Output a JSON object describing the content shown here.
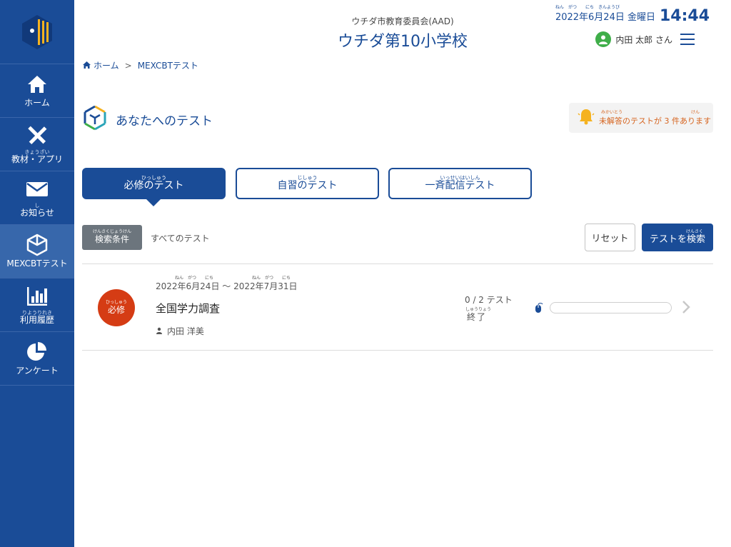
{
  "sidebar": {
    "items": [
      {
        "label": "ホーム",
        "ruby": "",
        "icon": "home-icon",
        "active": false
      },
      {
        "label": "教材・アプリ",
        "ruby": "きょうざい",
        "icon": "pencil-ruler-icon",
        "active": false
      },
      {
        "label": "お知らせ",
        "ruby": "し",
        "icon": "mail-icon",
        "active": false
      },
      {
        "label": "MEXCBTテスト",
        "ruby": "",
        "icon": "cube-icon",
        "active": true
      },
      {
        "label": "利用履歴",
        "ruby": "りようりれき",
        "icon": "bar-chart-icon",
        "active": false
      },
      {
        "label": "アンケート",
        "ruby": "",
        "icon": "pie-chart-icon",
        "active": false
      }
    ]
  },
  "header": {
    "org": "ウチダ市教育委員会(AAD)",
    "school": "ウチダ第10小学校",
    "date": "2022年6月24日 金曜日",
    "date_ruby": "ねん　がつ　　にち　きんようび",
    "time": "14:44",
    "user": "内田 太郎 さん"
  },
  "breadcrumb": {
    "home": "ホーム",
    "separator": ">",
    "current": "MEXCBTテスト"
  },
  "section": {
    "title": "あなたへのテスト"
  },
  "alert": {
    "text": "未解答のテストが 3 件あります",
    "ruby1": "みかいとう",
    "ruby2": "けん"
  },
  "tabs": [
    {
      "label": "必修のテスト",
      "ruby": "ひっしゅう",
      "active": true
    },
    {
      "label": "自習のテスト",
      "ruby": "じしゅう",
      "active": false
    },
    {
      "label": "一斉配信テスト",
      "ruby": "いっせいはいしん",
      "active": false
    }
  ],
  "filters": {
    "search_condition_label": "検索条件",
    "search_condition_ruby": "けんさくじょうけん",
    "current_filter": "すべてのテスト",
    "reset_label": "リセット",
    "search_label": "テストを検索",
    "search_ruby": "けんさく"
  },
  "tests": [
    {
      "badge": "必修",
      "badge_ruby": "ひっしゅう",
      "period": "2022年6月24日 〜 2022年7月31日",
      "title": "全国学力調査",
      "author": "内田 洋美",
      "count": "0 / 2 テスト",
      "status": "終了",
      "status_ruby": "しゅうりょう",
      "progress": 0
    }
  ],
  "colors": {
    "primary": "#1a4c97",
    "badge": "#d53c14",
    "alert_text": "#d6641f"
  }
}
